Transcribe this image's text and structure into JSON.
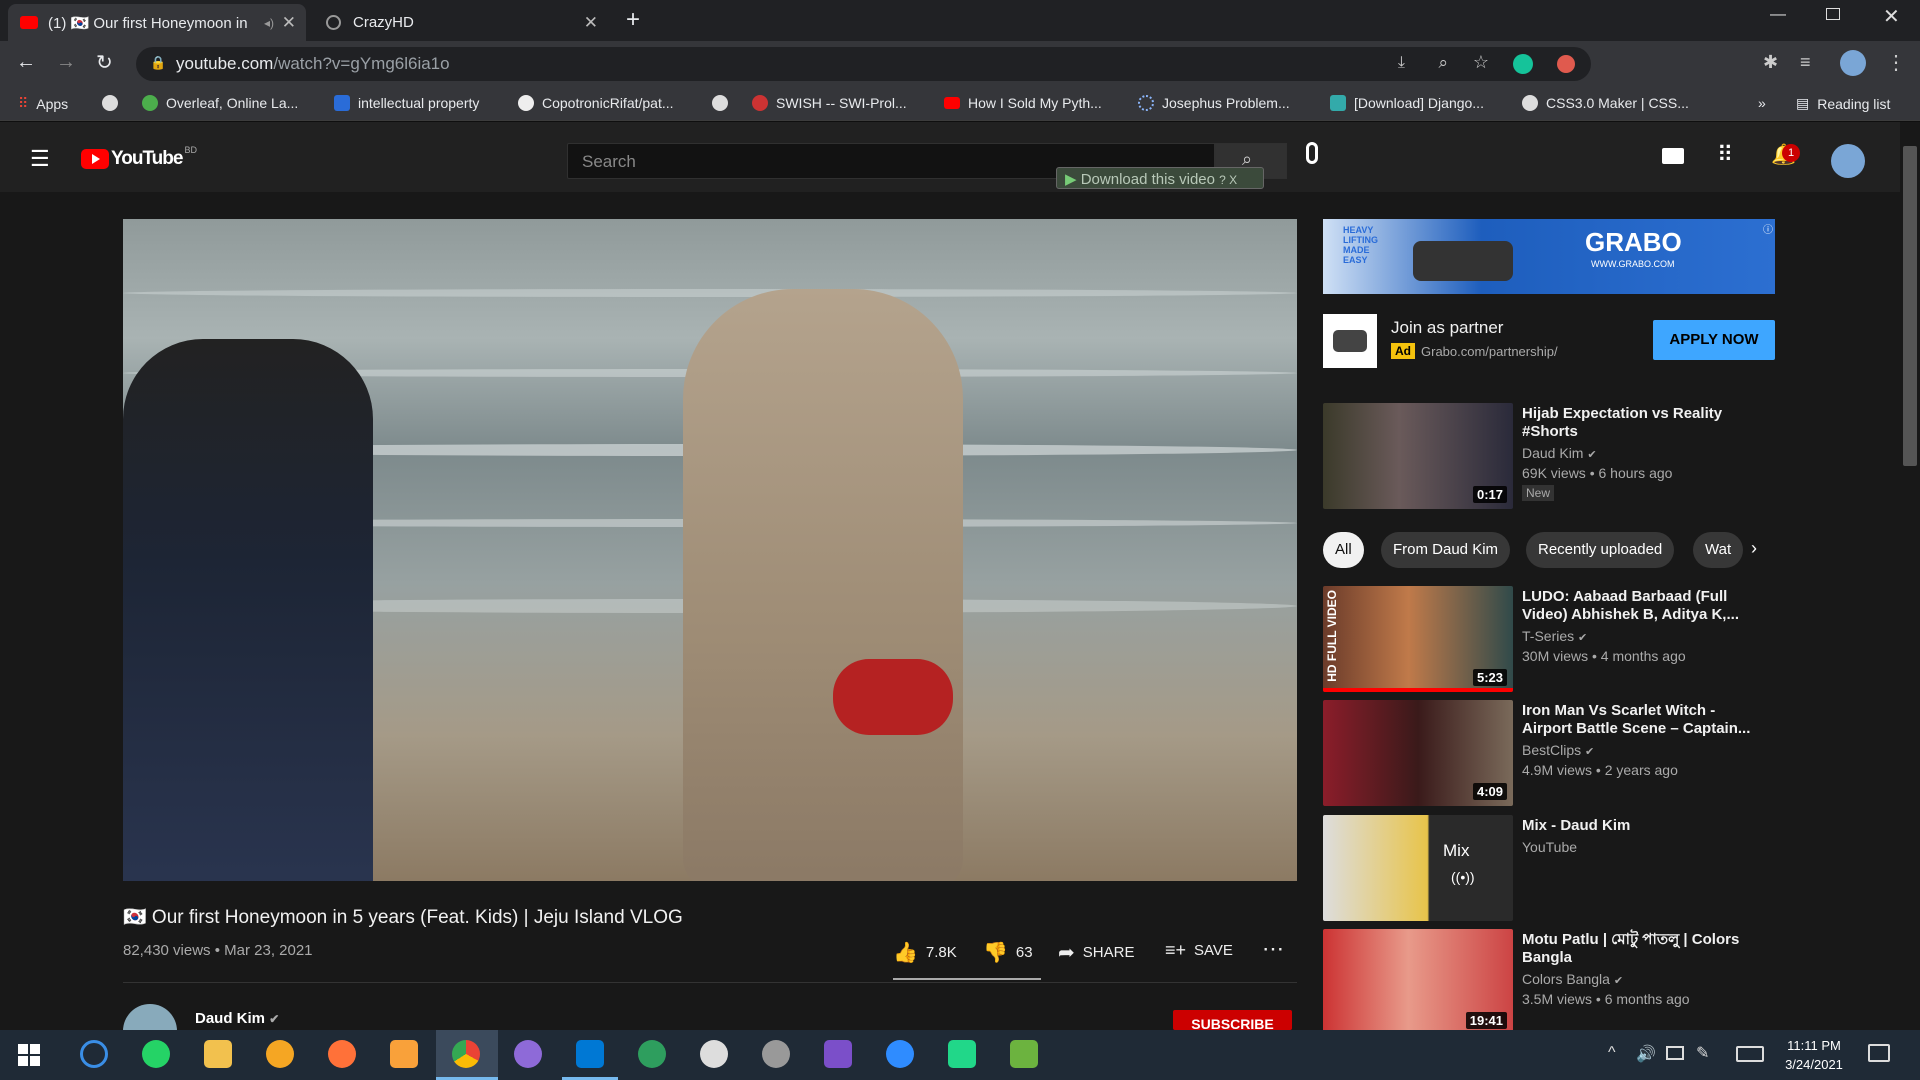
{
  "browser": {
    "tabs": [
      {
        "label": "(1) 🇰🇷 Our first Honeymoon in",
        "active": true
      },
      {
        "label": "CrazyHD",
        "active": false
      }
    ],
    "url_host": "youtube.com",
    "url_path": "/watch?v=gYmg6l6ia1o",
    "bookmarks": [
      "Apps",
      "Overleaf, Online La...",
      "intellectual property",
      "CopotronicRifat/pat...",
      "SWISH -- SWI-Prol...",
      "How I Sold My Pyth...",
      "Josephus Problem...",
      "[Download] Django...",
      "CSS3.0 Maker | CSS..."
    ],
    "more": "»",
    "reading_list": "Reading list"
  },
  "youtube": {
    "logo": "YouTube",
    "region": "BD",
    "search_placeholder": "Search",
    "download_label": "Download this video",
    "notification_count": "1",
    "video": {
      "title": "🇰🇷 Our first Honeymoon in 5 years (Feat. Kids) | Jeju Island VLOG",
      "views_date": "82,430 views • Mar 23, 2021",
      "likes": "7.8K",
      "dislikes": "63",
      "share": "SHARE",
      "save": "SAVE",
      "channel": "Daud Kim",
      "subscribe": "SUBSCRIBE"
    },
    "ad": {
      "banner_text": "GRABO",
      "banner_sub": "WWW.GRABO.COM",
      "banner_slogan": "HEAVY LIFTING MADE EASY",
      "title": "Join as partner",
      "badge": "Ad",
      "url": "Grabo.com/partnership/",
      "cta": "APPLY NOW"
    },
    "chips": [
      "All",
      "From Daud Kim",
      "Recently uploaded",
      "Wat"
    ],
    "recommendations": [
      {
        "title": "Hijab Expectation vs Reality #Shorts",
        "channel": "Daud Kim",
        "meta": "69K views • 6 hours ago",
        "badge": "New",
        "duration": "0:17"
      },
      {
        "title": "LUDO: Aabaad Barbaad (Full Video) Abhishek B, Aditya K,...",
        "channel": "T-Series",
        "meta": "30M views • 4 months ago",
        "duration": "5:23",
        "thumb_text": "HD FULL VIDEO"
      },
      {
        "title": "Iron Man Vs Scarlet Witch - Airport Battle Scene – Captain...",
        "channel": "BestClips",
        "meta": "4.9M views • 2 years ago",
        "duration": "4:09"
      },
      {
        "title": "Mix - Daud Kim",
        "channel": "YouTube",
        "meta": "",
        "mix": "Mix"
      },
      {
        "title": "Motu Patlu | মোটু পাতলু | Colors Bangla",
        "channel": "Colors Bangla",
        "meta": "3.5M views • 6 months ago",
        "duration": "19:41"
      }
    ]
  },
  "taskbar": {
    "time": "11:11 PM",
    "date": "3/24/2021"
  },
  "colors": {
    "accent_red": "#ff0000",
    "ad_blue": "#3ea6ff",
    "bg": "#181818"
  }
}
